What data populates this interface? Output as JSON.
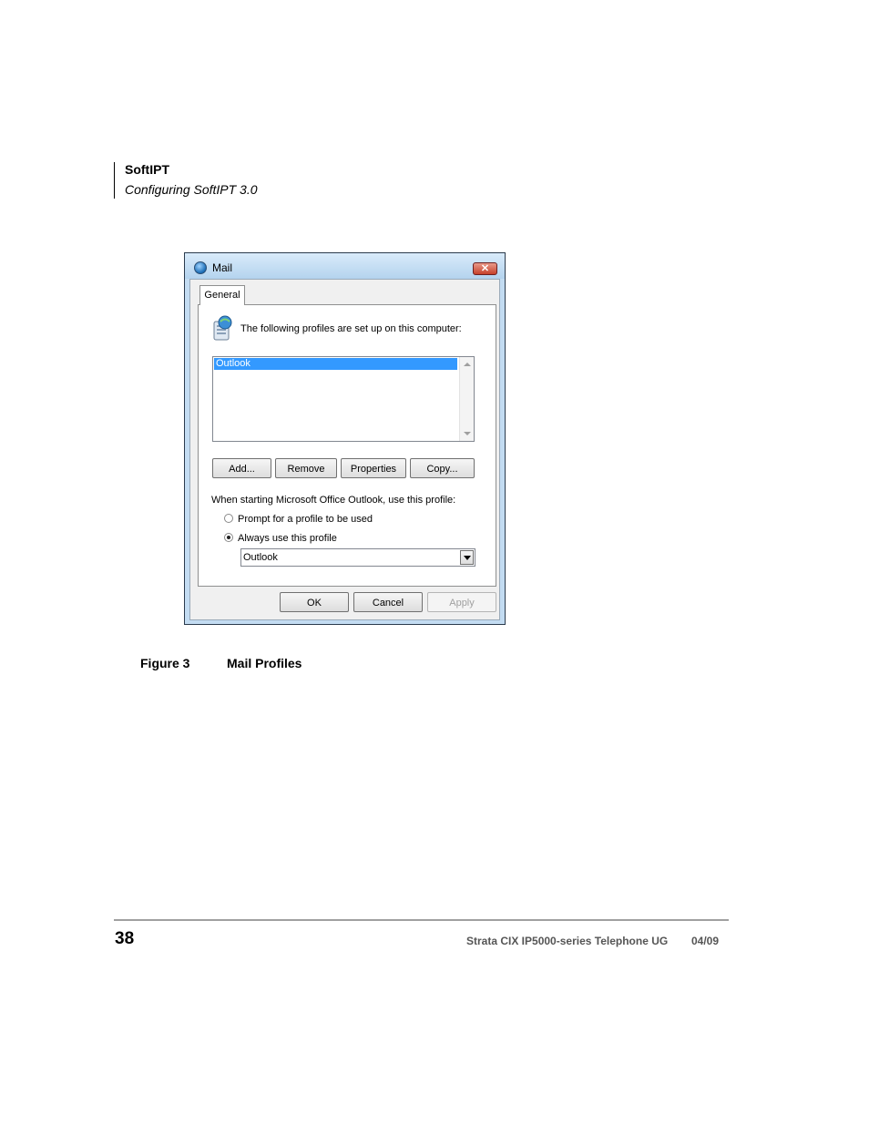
{
  "header": {
    "title": "SoftIPT",
    "subtitle": "Configuring SoftIPT 3.0"
  },
  "dialog": {
    "title": "Mail",
    "close_glyph": "✕",
    "tab_general": "General",
    "intro_text": "The following profiles are set up on this computer:",
    "profiles": [
      "Outlook"
    ],
    "buttons": {
      "add": "Add...",
      "remove": "Remove",
      "properties": "Properties",
      "copy": "Copy..."
    },
    "startup_label": "When starting Microsoft Office Outlook, use this profile:",
    "radio_prompt": "Prompt for a profile to be used",
    "radio_always": "Always use this profile",
    "selected_profile": "Outlook",
    "ok": "OK",
    "cancel": "Cancel",
    "apply": "Apply"
  },
  "caption": {
    "number": "Figure 3",
    "title": "Mail Profiles"
  },
  "footer": {
    "page_number": "38",
    "document": "Strata CIX IP5000-series Telephone UG",
    "date": "04/09"
  },
  "colors": {
    "selection": "#3399ff",
    "window_frame": "#c3dcf2",
    "close_button": "#c6402a"
  }
}
